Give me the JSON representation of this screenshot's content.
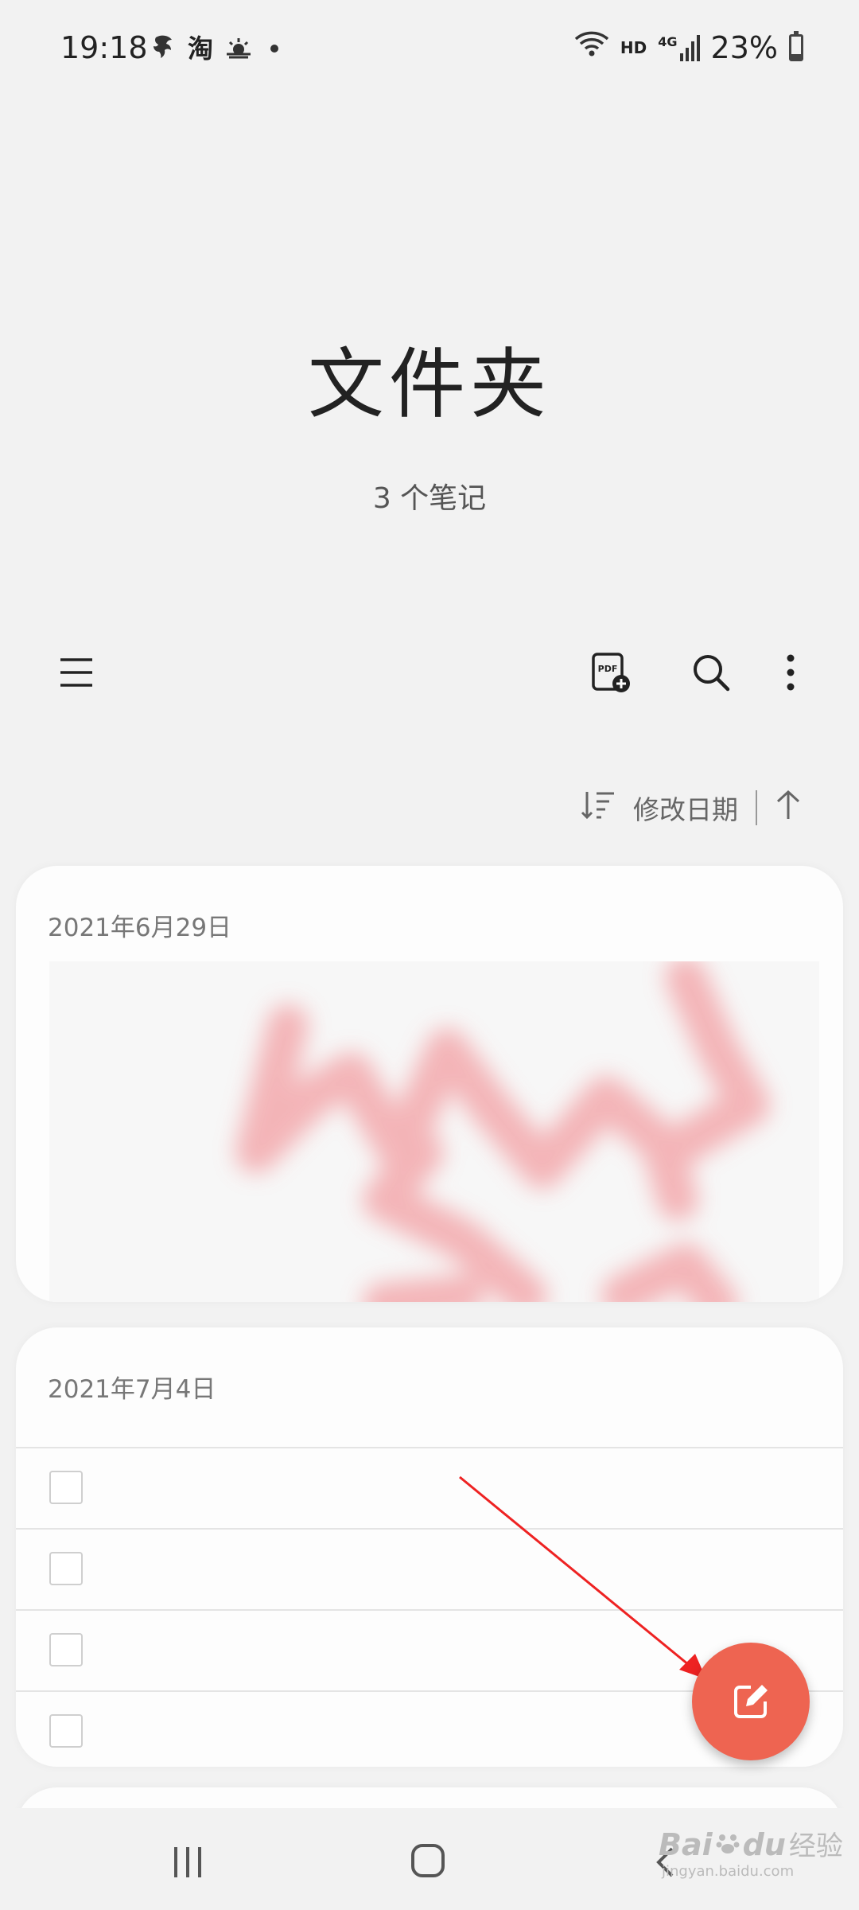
{
  "status_bar": {
    "time": "19:18",
    "app_icon_label": "淘",
    "network_hd": "HD",
    "network_4g": "4G",
    "battery_percent": "23%",
    "battery_level": 0.23
  },
  "header": {
    "title": "文件夹",
    "note_count": "3 个笔记"
  },
  "toolbar": {
    "menu_icon": "hamburger-menu-icon",
    "pdf_icon": "pdf-add-icon",
    "pdf_icon_text": "PDF",
    "search_icon": "search-icon",
    "more_icon": "more-vertical-icon"
  },
  "sort": {
    "label": "修改日期",
    "direction": "ascending"
  },
  "notes": [
    {
      "date": "2021年6月29日",
      "type": "drawing"
    },
    {
      "date": "2021年7月4日",
      "type": "checklist",
      "items": 4
    }
  ],
  "fab": {
    "icon": "compose-note-icon",
    "color": "#ee6451"
  },
  "watermark": {
    "brand": "Bai",
    "brand2": "du",
    "cn": "经验",
    "url": "jingyan.baidu.com"
  },
  "colors": {
    "background": "#f2f2f2",
    "card": "#fdfdfd",
    "annotation_arrow": "#ee2222"
  }
}
